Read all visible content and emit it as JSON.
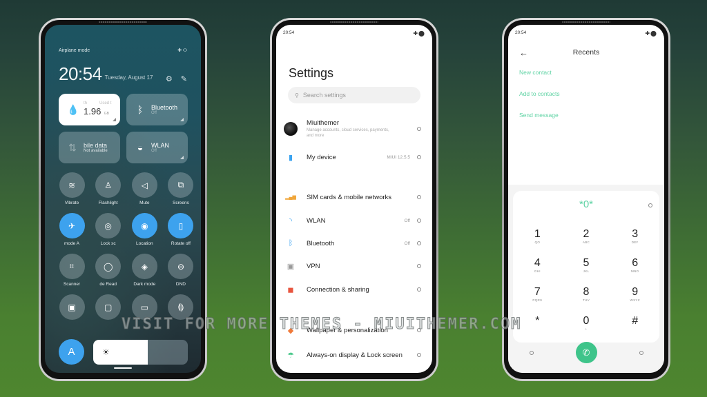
{
  "phone1": {
    "top_label": "Airplane mode",
    "time": "20:54",
    "date": "Tuesday, August 17",
    "tiles": [
      {
        "icon": "water-drop-icon",
        "title": "1.96",
        "unit": "GB",
        "top_left": "th",
        "top_right": "Used t",
        "style": "white"
      },
      {
        "icon": "bluetooth-icon",
        "title": "Bluetooth",
        "status": "Off"
      },
      {
        "icon": "mobile-data-icon",
        "title": "bile data",
        "status": "Not available"
      },
      {
        "icon": "wlan-icon",
        "title": "WLAN",
        "status": "Off"
      }
    ],
    "toggles": [
      [
        {
          "label": "Vibrate",
          "icon": "vibrate-icon",
          "on": false
        },
        {
          "label": "Flashlight",
          "icon": "flashlight-icon",
          "on": false
        },
        {
          "label": "Mute",
          "icon": "mute-icon",
          "on": false
        },
        {
          "label": "Screens",
          "icon": "screenshot-icon",
          "on": false
        }
      ],
      [
        {
          "label": "mode     A",
          "icon": "airplane-icon",
          "on": true
        },
        {
          "label": "Lock sc",
          "icon": "fingerprint-icon",
          "on": false
        },
        {
          "label": "Location",
          "icon": "location-icon",
          "on": true
        },
        {
          "label": "Rotate off",
          "icon": "rotate-icon",
          "on": true
        }
      ],
      [
        {
          "label": "Scanner",
          "icon": "scanner-icon",
          "on": false
        },
        {
          "label": "de     Read",
          "icon": "eye-icon",
          "on": false
        },
        {
          "label": "Dark mode",
          "icon": "dark-mode-icon",
          "on": false
        },
        {
          "label": "DND",
          "icon": "dnd-icon",
          "on": false
        }
      ],
      [
        {
          "label": "",
          "icon": "battery-saver-icon",
          "on": false
        },
        {
          "label": "",
          "icon": "battery-icon",
          "on": false
        },
        {
          "label": "",
          "icon": "cast-icon",
          "on": false
        },
        {
          "label": "",
          "icon": "nfc-icon",
          "on": false
        }
      ]
    ],
    "auto_brightness_label": "A",
    "brightness_level": 0.58
  },
  "phone2": {
    "status_time": "20:54",
    "title": "Settings",
    "search_placeholder": "Search settings",
    "items": [
      {
        "label": "Miuithemer",
        "sub": "Manage accounts, cloud services, payments, and more",
        "value": "",
        "icon": "account-avatar"
      },
      {
        "label": "My device",
        "sub": "",
        "value": "MIUI 12.5.5",
        "icon": "device-icon",
        "color": "#3aa3f0"
      },
      {
        "label": "SIM cards & mobile networks",
        "sub": "",
        "value": "",
        "icon": "sim-icon",
        "color": "#f0a63a"
      },
      {
        "label": "WLAN",
        "sub": "",
        "value": "Off",
        "icon": "wifi-icon",
        "color": "#3aa3f0"
      },
      {
        "label": "Bluetooth",
        "sub": "",
        "value": "Off",
        "icon": "bluetooth-icon",
        "color": "#3aa3f0"
      },
      {
        "label": "VPN",
        "sub": "",
        "value": "",
        "icon": "vpn-icon",
        "color": "#999999"
      },
      {
        "label": "Connection & sharing",
        "sub": "",
        "value": "",
        "icon": "connection-icon",
        "color": "#e8553f"
      },
      {
        "label": "Wallpaper & personalization",
        "sub": "",
        "value": "",
        "icon": "wallpaper-icon",
        "color": "#f07a3a"
      },
      {
        "label": "Always-on display & Lock screen",
        "sub": "",
        "value": "",
        "icon": "lock-screen-icon",
        "color": "#4cc98c"
      }
    ]
  },
  "phone3": {
    "status_time": "20:54",
    "title": "Recents",
    "links": [
      "New contact",
      "Add to contacts",
      "Send message"
    ],
    "entry": "*0*",
    "keys": [
      {
        "n": "1",
        "l": "QO"
      },
      {
        "n": "2",
        "l": "ABC"
      },
      {
        "n": "3",
        "l": "DEF"
      },
      {
        "n": "4",
        "l": "GHI"
      },
      {
        "n": "5",
        "l": "JKL"
      },
      {
        "n": "6",
        "l": "MNO"
      },
      {
        "n": "7",
        "l": "PQRS"
      },
      {
        "n": "8",
        "l": "TUV"
      },
      {
        "n": "9",
        "l": "WXYZ"
      },
      {
        "n": "*",
        "l": ""
      },
      {
        "n": "0",
        "l": "+"
      },
      {
        "n": "#",
        "l": ""
      }
    ]
  },
  "colors": {
    "accent_blue": "#3da2ee",
    "accent_green": "#5fd3a4",
    "call_green": "#3ec48a"
  },
  "watermark": "VISIT FOR MORE THEMES - MIUITHEMER.COM"
}
